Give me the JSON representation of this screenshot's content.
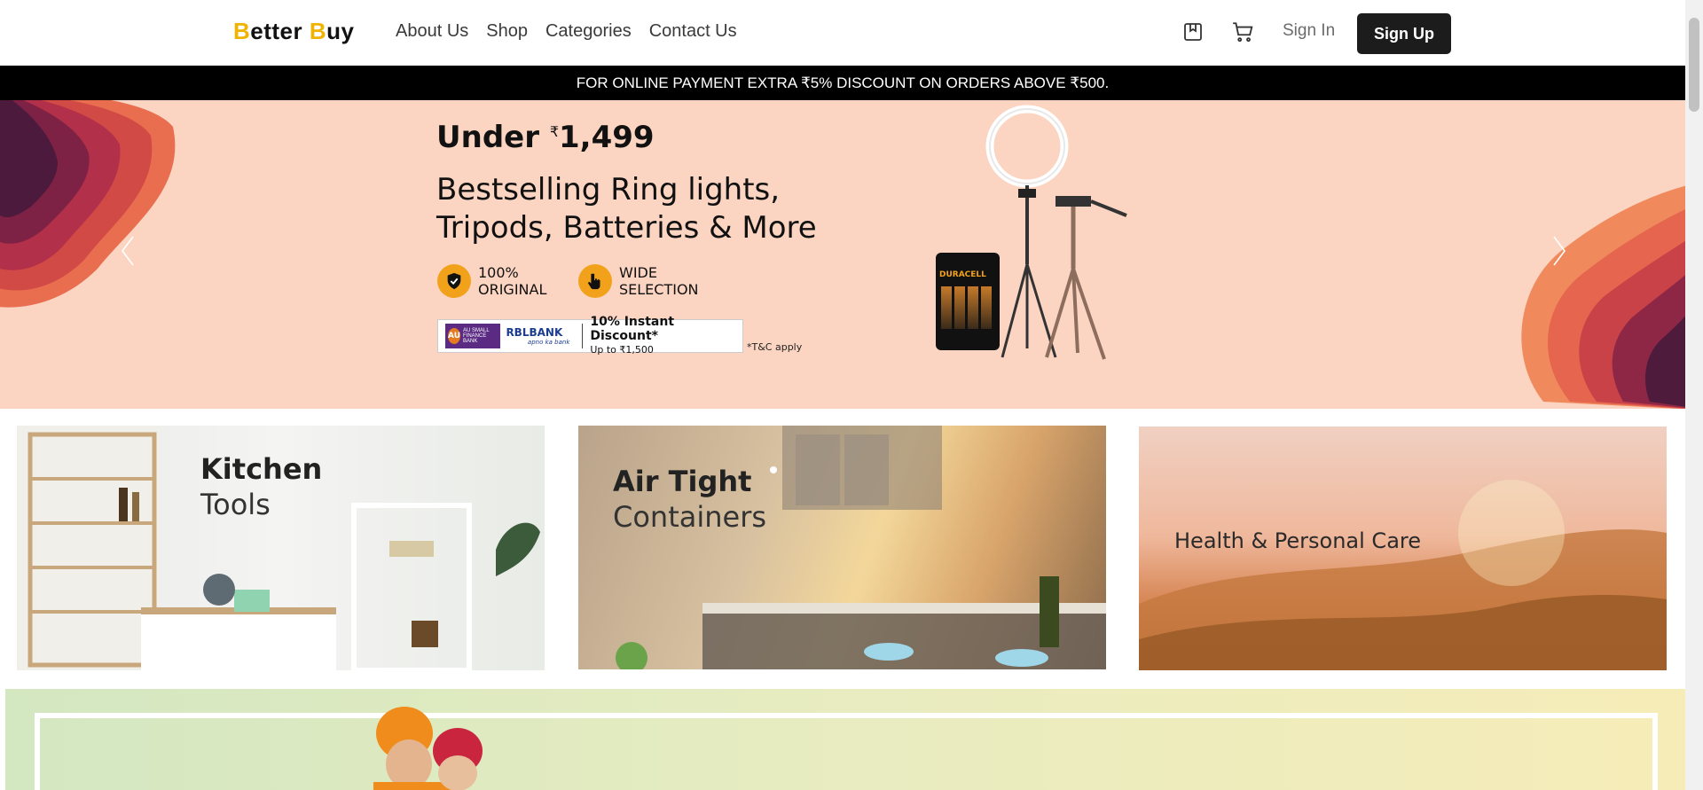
{
  "header": {
    "logo_b1": "B",
    "logo_rest1": "etter ",
    "logo_b2": "B",
    "logo_rest2": "uy",
    "nav": [
      "About Us",
      "Shop",
      "Categories",
      "Contact Us"
    ],
    "wishlist_icon": "bookmark-icon",
    "cart_icon": "cart-icon",
    "signin_label": "Sign In",
    "signup_label": "Sign Up"
  },
  "announcement": "FOR ONLINE PAYMENT EXTRA ₹5% DISCOUNT ON ORDERS ABOVE ₹500.",
  "hero": {
    "price_prefix": "Under",
    "price_symbol": "₹",
    "price_value": "1,499",
    "title_line1": "Bestselling Ring lights,",
    "title_line2": "Tripods, Batteries & More",
    "badge1_line1": "100%",
    "badge1_line2": "ORIGINAL",
    "badge2_line1": "WIDE",
    "badge2_line2": "SELECTION",
    "bank_au": "AU",
    "bank_au_sub": "AU SMALL FINANCE BANK",
    "bank_rbl": "RBLBANK",
    "bank_rbl_tag": "apno ka bank",
    "discount_line1": "10% Instant Discount*",
    "discount_line2": "Up to ₹1,500",
    "terms": "*T&C apply",
    "battery_brand": "DURACELL"
  },
  "tiles": [
    {
      "title_bold": "Kitchen",
      "title_light": "Tools"
    },
    {
      "title_bold": "Air Tight",
      "title_light": "Containers"
    },
    {
      "title_bold": "",
      "title_light": "Health & Personal Care"
    }
  ],
  "colors": {
    "brand_accent": "#f0b400",
    "hero_bg": "#fbd5c2",
    "announcement_bg": "#000000",
    "signup_bg": "#1c1c1c"
  }
}
